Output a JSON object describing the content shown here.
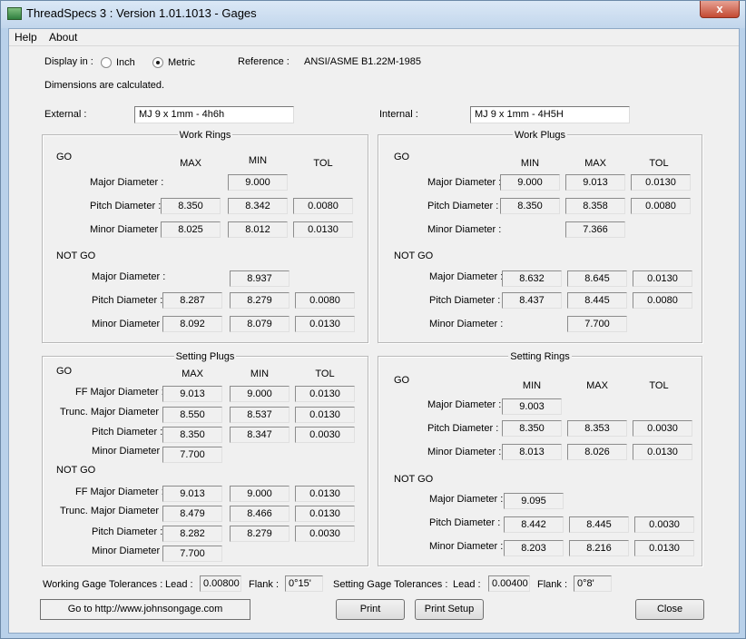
{
  "window": {
    "title": "ThreadSpecs 3 : Version 1.01.1013 - Gages",
    "close_glyph": "x"
  },
  "menu": [
    "Help",
    "About"
  ],
  "display": {
    "label": "Display in :",
    "inch": "Inch",
    "metric": "Metric",
    "selected": "Metric"
  },
  "reference": {
    "label": "Reference :",
    "value": "ANSI/ASME B1.22M-1985"
  },
  "note": "Dimensions are calculated.",
  "external": {
    "label": "External :",
    "value": "MJ 9 x 1mm - 4h6h"
  },
  "internal": {
    "label": "Internal :",
    "value": "MJ 9 x 1mm - 4H5H"
  },
  "labels": {
    "go": "GO",
    "notgo": "NOT GO",
    "go2": "NOT GO",
    "max": "MAX",
    "min": "MIN",
    "tol": "TOL",
    "major": "Major Diameter :",
    "pitch": "Pitch Diameter :",
    "minor": "Minor Diameter :",
    "major_nc": "Major Diameter :",
    "ff_major": "FF Major Diameter :",
    "trunc_major": "Trunc. Major Diameter :"
  },
  "work_rings": {
    "title": "Work Rings",
    "go": {
      "major": [
        "",
        "9.000",
        ""
      ],
      "pitch": [
        "8.350",
        "8.342",
        "0.0080"
      ],
      "minor": [
        "8.025",
        "8.012",
        "0.0130"
      ]
    },
    "notgo": {
      "major": [
        "",
        "8.937",
        ""
      ],
      "pitch": [
        "8.287",
        "8.279",
        "0.0080"
      ],
      "minor": [
        "8.092",
        "8.079",
        "0.0130"
      ]
    }
  },
  "work_plugs": {
    "title": "Work Plugs",
    "go": {
      "major": [
        "9.000",
        "9.013",
        "0.0130"
      ],
      "pitch": [
        "8.350",
        "8.358",
        "0.0080"
      ],
      "minor": [
        "",
        "7.366",
        ""
      ]
    },
    "notgo": {
      "major": [
        "8.632",
        "8.645",
        "0.0130"
      ],
      "pitch": [
        "8.437",
        "8.445",
        "0.0080"
      ],
      "minor": [
        "",
        "7.700",
        ""
      ]
    }
  },
  "setting_plugs": {
    "title": "Setting Plugs",
    "go": {
      "ff_major": [
        "9.013",
        "9.000",
        "0.0130"
      ],
      "trunc_major": [
        "8.550",
        "8.537",
        "0.0130"
      ],
      "pitch": [
        "8.350",
        "8.347",
        "0.0030"
      ],
      "minor": [
        "7.700",
        "",
        ""
      ]
    },
    "notgo": {
      "ff_major": [
        "9.013",
        "9.000",
        "0.0130"
      ],
      "trunc_major": [
        "8.479",
        "8.466",
        "0.0130"
      ],
      "pitch": [
        "8.282",
        "8.279",
        "0.0030"
      ],
      "minor": [
        "7.700",
        "",
        ""
      ]
    }
  },
  "setting_rings": {
    "title": "Setting Rings",
    "go": {
      "major": [
        "9.003",
        "",
        ""
      ],
      "pitch": [
        "8.350",
        "8.353",
        "0.0030"
      ],
      "minor": [
        "8.013",
        "8.026",
        "0.0130"
      ]
    },
    "notgo": {
      "major": [
        "9.095",
        "",
        ""
      ],
      "pitch": [
        "8.442",
        "8.445",
        "0.0030"
      ],
      "minor": [
        "8.203",
        "8.216",
        "0.0130"
      ]
    }
  },
  "tolerances": {
    "working_label": "Working Gage Tolerances :",
    "lead_label": "Lead :",
    "flank_label": "Flank :",
    "working_lead": "0.00800",
    "working_flank": "0°15'",
    "setting_label": "Setting Gage Tolerances :",
    "setting_lead": "0.00400",
    "setting_flank": "0°8'"
  },
  "buttons": {
    "goto": "Go to http://www.johnsongage.com",
    "print": "Print",
    "print_setup": "Print Setup",
    "close": "Close"
  }
}
